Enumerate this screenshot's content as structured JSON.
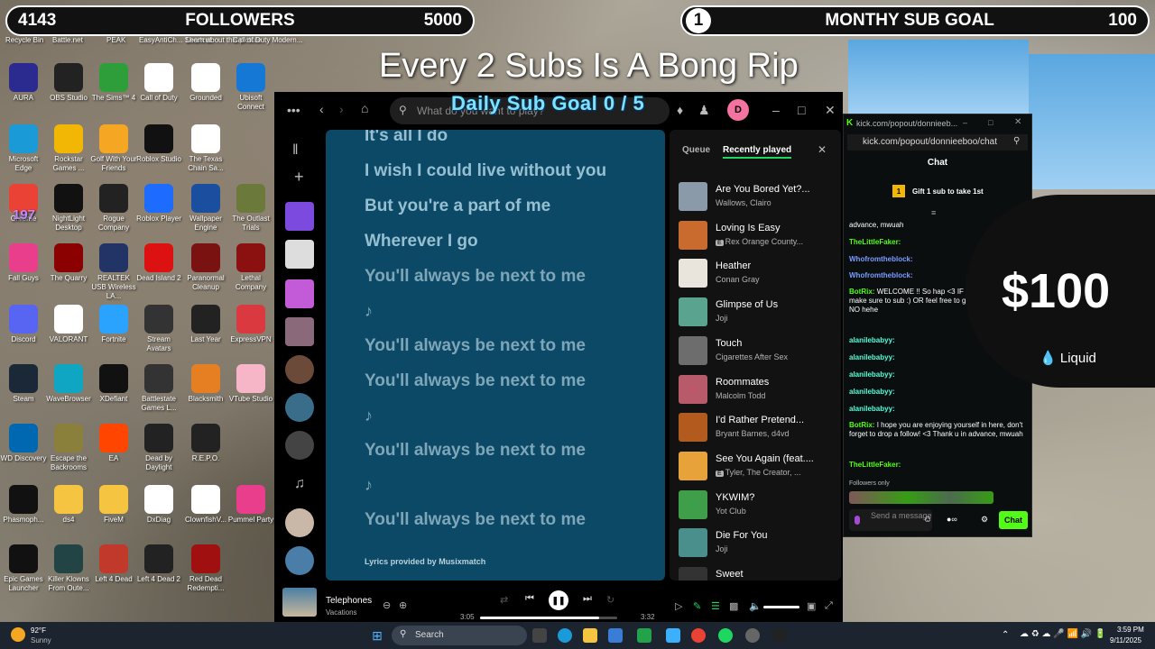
{
  "overlay": {
    "followers_current": "4143",
    "followers_label": "FOLLOWERS",
    "followers_goal": "5000",
    "sub_current": "1",
    "sub_label": "MONTHY SUB GOAL",
    "sub_goal": "100",
    "title": "Every 2 Subs Is A Bong Rip",
    "daily_goal": "Daily Sub Goal  0 / 5"
  },
  "desktop": {
    "top_labels": [
      "Recycle Bin",
      "Battle.net",
      "PEAK",
      "EasyAntiCh... Shortcut",
      "Learn about this picture",
      "Call of Duty Modern..."
    ],
    "icons": [
      {
        "label": "AURA",
        "icon": "aura-icon",
        "color": "#2b2b8f"
      },
      {
        "label": "OBS Studio",
        "icon": "obs-icon",
        "color": "#222"
      },
      {
        "label": "The Sims™ 4",
        "icon": "sims-icon",
        "color": "#2e9e3a"
      },
      {
        "label": "Call of Duty",
        "icon": "cod-icon",
        "color": "#fff"
      },
      {
        "label": "Grounded",
        "icon": "file-icon",
        "color": "#fff"
      },
      {
        "label": "Ubisoft Connect",
        "icon": "ubisoft-icon",
        "color": "#1478d4"
      },
      {
        "label": "Microsoft Edge",
        "icon": "edge-icon",
        "color": "#1a9bd7"
      },
      {
        "label": "Rockstar Games ...",
        "icon": "rockstar-icon",
        "color": "#f2b705"
      },
      {
        "label": "Golf With Your Friends",
        "icon": "golf-icon",
        "color": "#f5a623"
      },
      {
        "label": "Roblox Studio",
        "icon": "roblox-studio-icon",
        "color": "#111"
      },
      {
        "label": "The Texas Chain Sa...",
        "icon": "file-icon",
        "color": "#fff"
      },
      {
        "label": "Chrome",
        "icon": "chrome-icon",
        "color": "#ea4335"
      },
      {
        "label": "NightLight Desktop",
        "icon": "nightlight-icon",
        "color": "#111"
      },
      {
        "label": "Rogue Company",
        "icon": "rogue-icon",
        "color": "#222"
      },
      {
        "label": "Roblox Player",
        "icon": "roblox-icon",
        "color": "#1e6bff"
      },
      {
        "label": "Wallpaper Engine",
        "icon": "wallpaper-icon",
        "color": "#1a4f9f"
      },
      {
        "label": "The Outlast Trials",
        "icon": "outlast-icon",
        "color": "#6b7a3a"
      },
      {
        "label": "Fall Guys",
        "icon": "fallguys-icon",
        "color": "#e83e8c"
      },
      {
        "label": "The Quarry",
        "icon": "quarry-icon",
        "color": "#8b0000"
      },
      {
        "label": "REALTEK USB Wireless LA...",
        "icon": "realtek-icon",
        "color": "#223366"
      },
      {
        "label": "Dead Island 2",
        "icon": "deadisland-icon",
        "color": "#d11"
      },
      {
        "label": "Paranormal Cleanup",
        "icon": "paranormal-icon",
        "color": "#7a1212"
      },
      {
        "label": "Lethal Company",
        "icon": "lethal-icon",
        "color": "#8b1010"
      },
      {
        "label": "Discord",
        "icon": "discord-icon",
        "color": "#5865f2"
      },
      {
        "label": "VALORANT",
        "icon": "file-icon",
        "color": "#fff"
      },
      {
        "label": "Fortnite",
        "icon": "fortnite-icon",
        "color": "#2aa3ff"
      },
      {
        "label": "Stream Avatars",
        "icon": "avatars-icon",
        "color": "#333"
      },
      {
        "label": "Last Year",
        "icon": "lastyear-icon",
        "color": "#222"
      },
      {
        "label": "ExpressVPN",
        "icon": "expressvpn-icon",
        "color": "#da3940"
      },
      {
        "label": "Steam",
        "icon": "steam-icon",
        "color": "#1b2838"
      },
      {
        "label": "WaveBrowser",
        "icon": "wave-icon",
        "color": "#0fa6c4"
      },
      {
        "label": "XDefiant",
        "icon": "xdefiant-icon",
        "color": "#111"
      },
      {
        "label": "Battlestate Games L...",
        "icon": "battlestate-icon",
        "color": "#333"
      },
      {
        "label": "Blacksmith",
        "icon": "blacksmith-icon",
        "color": "#e67e22"
      },
      {
        "label": "VTube Studio",
        "icon": "vtube-icon",
        "color": "#f7b6c8"
      },
      {
        "label": "WD Discovery",
        "icon": "wd-icon",
        "color": "#0067b1"
      },
      {
        "label": "Escape the Backrooms",
        "icon": "backrooms-icon",
        "color": "#8a7f3b"
      },
      {
        "label": "EA",
        "icon": "ea-icon",
        "color": "#ff4500"
      },
      {
        "label": "Dead by Daylight",
        "icon": "dbd-icon",
        "color": "#222"
      },
      {
        "label": "R.E.P.O.",
        "icon": "repo-icon",
        "color": "#222"
      },
      {
        "label": "Phasmoph...",
        "icon": "phasmo-icon",
        "color": "#111"
      },
      {
        "label": "ds4",
        "icon": "folder-icon",
        "color": "#f5c542"
      },
      {
        "label": "FiveM",
        "icon": "folder-icon",
        "color": "#f5c542"
      },
      {
        "label": "DxDiag",
        "icon": "file-icon",
        "color": "#fff"
      },
      {
        "label": "ClownfishV...",
        "icon": "clownfish-icon",
        "color": "#fff"
      },
      {
        "label": "Pummel Party",
        "icon": "pummel-icon",
        "color": "#e83e8c"
      },
      {
        "label": "Epic Games Launcher",
        "icon": "epic-icon",
        "color": "#111"
      },
      {
        "label": "Killer Klowns From Oute...",
        "icon": "klowns-icon",
        "color": "#244"
      },
      {
        "label": "Left 4 Dead",
        "icon": "l4d-icon",
        "color": "#c0392b"
      },
      {
        "label": "Left 4 Dead 2",
        "icon": "l4d2-icon",
        "color": "#222"
      },
      {
        "label": "Red Dead Redempti...",
        "icon": "rdr-icon",
        "color": "#a01010"
      }
    ],
    "badge_197": "197"
  },
  "spotify": {
    "search_placeholder": "What do you want to play?",
    "avatar_letter": "D",
    "lyrics": [
      "It's all I do",
      "I wish I could live without you",
      "But you're a part of me",
      "Wherever I go",
      "You'll always be next to me",
      "♪",
      "You'll always be next to me",
      "You'll always be next to me",
      "♪",
      "You'll always be next to me",
      "♪",
      "You'll always be next to me"
    ],
    "lyrics_credit": "Lyrics provided by Musixmatch",
    "queue_tab": "Queue",
    "recent_tab": "Recently played",
    "recent": [
      {
        "title": "Are You Bored Yet?...",
        "artist": "Wallows, Clairo",
        "explicit": false,
        "color": "#8a9aa8"
      },
      {
        "title": "Loving Is Easy",
        "artist": "Rex Orange County...",
        "explicit": true,
        "color": "#c96a2e"
      },
      {
        "title": "Heather",
        "artist": "Conan Gray",
        "explicit": false,
        "color": "#e9e4dc"
      },
      {
        "title": "Glimpse of Us",
        "artist": "Joji",
        "explicit": false,
        "color": "#5aa38f"
      },
      {
        "title": "Touch",
        "artist": "Cigarettes After Sex",
        "explicit": false,
        "color": "#6d6d6d"
      },
      {
        "title": "Roommates",
        "artist": "Malcolm Todd",
        "explicit": false,
        "color": "#b85a6a"
      },
      {
        "title": "I'd Rather Pretend...",
        "artist": "Bryant Barnes, d4vd",
        "explicit": false,
        "color": "#b35a1e"
      },
      {
        "title": "See You Again (feat....",
        "artist": "Tyler, The Creator, ...",
        "explicit": true,
        "color": "#e8a23a"
      },
      {
        "title": "YKWIM?",
        "artist": "Yot Club",
        "explicit": false,
        "color": "#3f9e4a"
      },
      {
        "title": "Die For You",
        "artist": "Joji",
        "explicit": false,
        "color": "#4a8f8c"
      },
      {
        "title": "Sweet",
        "artist": "",
        "explicit": false,
        "color": "#333"
      }
    ],
    "now_playing": {
      "title": "Telephones",
      "artist": "Vacations"
    },
    "time_elapsed": "3:05",
    "time_total": "3:32",
    "progress": 0.87
  },
  "kick": {
    "window_title": "kick.com/popout/donnieeb...",
    "url": "kick.com/popout/donnieeboo/chat",
    "chat_header": "Chat",
    "gift_text": "Gift 1 sub to take 1st",
    "messages": [
      {
        "user": "",
        "text": "advance, mwuah",
        "cls": ""
      },
      {
        "user": "TheLittleFaker:",
        "text": "",
        "cls": "uname-g"
      },
      {
        "user": "Whofromtheblock:",
        "text": "",
        "cls": "uname-b"
      },
      {
        "user": "Whofromtheblock:",
        "text": "",
        "cls": "uname-b"
      },
      {
        "user": "BotRix:",
        "text": "WELCOME !! So hap <3 IF you are enjoying make sure to sub :) OR feel free to gift some bitti YEAH NO hehe",
        "cls": "uname-g"
      },
      {
        "user": "alanilebabyy:",
        "text": "",
        "cls": "uname-c"
      },
      {
        "user": "alanilebabyy:",
        "text": "",
        "cls": "uname-c"
      },
      {
        "user": "alanilebabyy:",
        "text": "",
        "cls": "uname-c"
      },
      {
        "user": "alanilebabyy:",
        "text": "",
        "cls": "uname-c"
      },
      {
        "user": "alanilebabyy:",
        "text": "",
        "cls": "uname-c"
      },
      {
        "user": "BotRix:",
        "text": "I hope you are enjoying yourself in here, don't forget to drop a follow! <3 Thank u in advance, mwuah",
        "cls": "uname-g"
      },
      {
        "user": "TheLittleFaker:",
        "text": "",
        "cls": "uname-g"
      }
    ],
    "followers_only": "Followers only",
    "send_placeholder": "Send a message",
    "chat_button": "Chat"
  },
  "donation": {
    "amount": "$100",
    "brand": "Liquid"
  },
  "taskbar": {
    "weather_temp": "92°F",
    "weather_desc": "Sunny",
    "search": "Search",
    "time": "3:59 PM",
    "date": "9/11/2025"
  }
}
